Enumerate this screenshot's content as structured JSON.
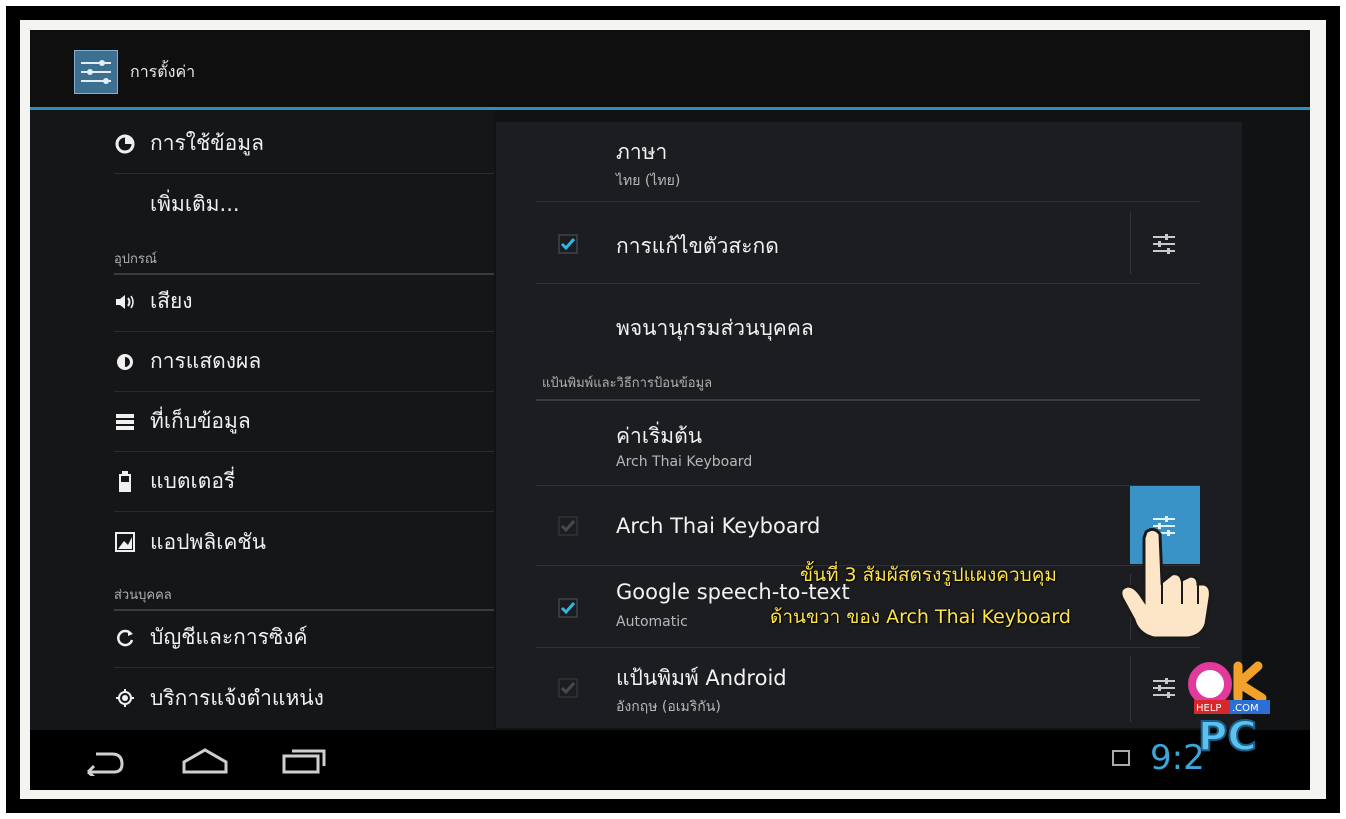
{
  "actionbar": {
    "title": "การตั้งค่า",
    "icon": "settings-sliders-icon"
  },
  "left_menu": {
    "item_data_usage": "การใช้ข้อมูล",
    "item_more": "เพิ่มเติม...",
    "header_device": "อุปกรณ์",
    "item_sound": "เสียง",
    "item_display": "การแสดงผล",
    "item_storage": "ที่เก็บข้อมูล",
    "item_battery": "แบตเตอรี่",
    "item_apps": "แอปพลิเคชัน",
    "header_personal": "ส่วนบุคคล",
    "item_accounts": "บัญชีและการซิงค์",
    "item_location": "บริการแจ้งตำแหน่ง"
  },
  "right_panel": {
    "language_title": "ภาษา",
    "language_value": "ไทย (ไทย)",
    "spell_title": "การแก้ไขตัวสะกด",
    "spell_checked": true,
    "dictionary_title": "พจนานุกรมส่วนบุคคล",
    "header_keyboard": "แป้นพิมพ์และวิธีการป้อนข้อมูล",
    "default_title": "ค่าเริ่มต้น",
    "default_value": "Arch Thai Keyboard",
    "arch_title": "Arch Thai Keyboard",
    "arch_checked": true,
    "google_title": "Google speech-to-text",
    "google_value": "Automatic",
    "google_checked": true,
    "android_title": "แป้นพิมพ์ Android",
    "android_value": "อังกฤษ (อเมริกัน)",
    "android_checked": true
  },
  "annotation": {
    "line1": "ขั้นที่ 3 สัมผัสตรงรูปแผงควบคุม",
    "line2": "ด้านขวา ของ Arch Thai Keyboard"
  },
  "navbar": {
    "clock": "9:2",
    "icons": [
      "back-icon",
      "home-icon",
      "recent-apps-icon",
      "gallery-notification-icon"
    ]
  },
  "watermark": {
    "top": "ok",
    "badge": "HELP.COM",
    "bottom": "PC"
  },
  "colors": {
    "accent": "#33b5e5",
    "highlight": "#3a93c6",
    "annotation": "#ffe34a"
  }
}
